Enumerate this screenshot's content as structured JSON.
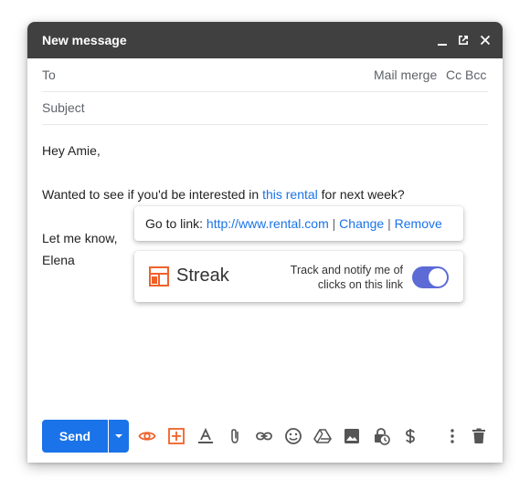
{
  "window": {
    "title": "New message"
  },
  "fields": {
    "to_label": "To",
    "mail_merge": "Mail merge",
    "cc_bcc": "Cc Bcc",
    "subject_placeholder": "Subject"
  },
  "body": {
    "greeting": "Hey Amie,",
    "line1_before": "Wanted to see if you'd be interested in ",
    "line1_link": "this rental",
    "line1_after": " for next week?",
    "closing": "Let me know,",
    "signature": "Elena"
  },
  "link_popup": {
    "go_to_label": "Go to link: ",
    "url": "http://www.rental.com",
    "sep1": " | ",
    "change": "Change",
    "sep2": " | ",
    "remove": "Remove"
  },
  "streak_popup": {
    "brand": "Streak",
    "track_line1": "Track and notify me of",
    "track_line2": "clicks on this link",
    "toggle_on": true
  },
  "toolbar": {
    "send_label": "Send",
    "icons": [
      "eye-icon",
      "streak-add-icon",
      "format-text-icon",
      "attach-icon",
      "link-icon",
      "emoji-icon",
      "drive-icon",
      "image-icon",
      "confidential-icon",
      "money-icon",
      "more-options-icon",
      "trash-icon"
    ]
  },
  "colors": {
    "titlebar": "#404040",
    "accent_blue": "#1a73e8",
    "streak_orange": "#f0612a",
    "toggle_blue": "#5c6bd6"
  }
}
